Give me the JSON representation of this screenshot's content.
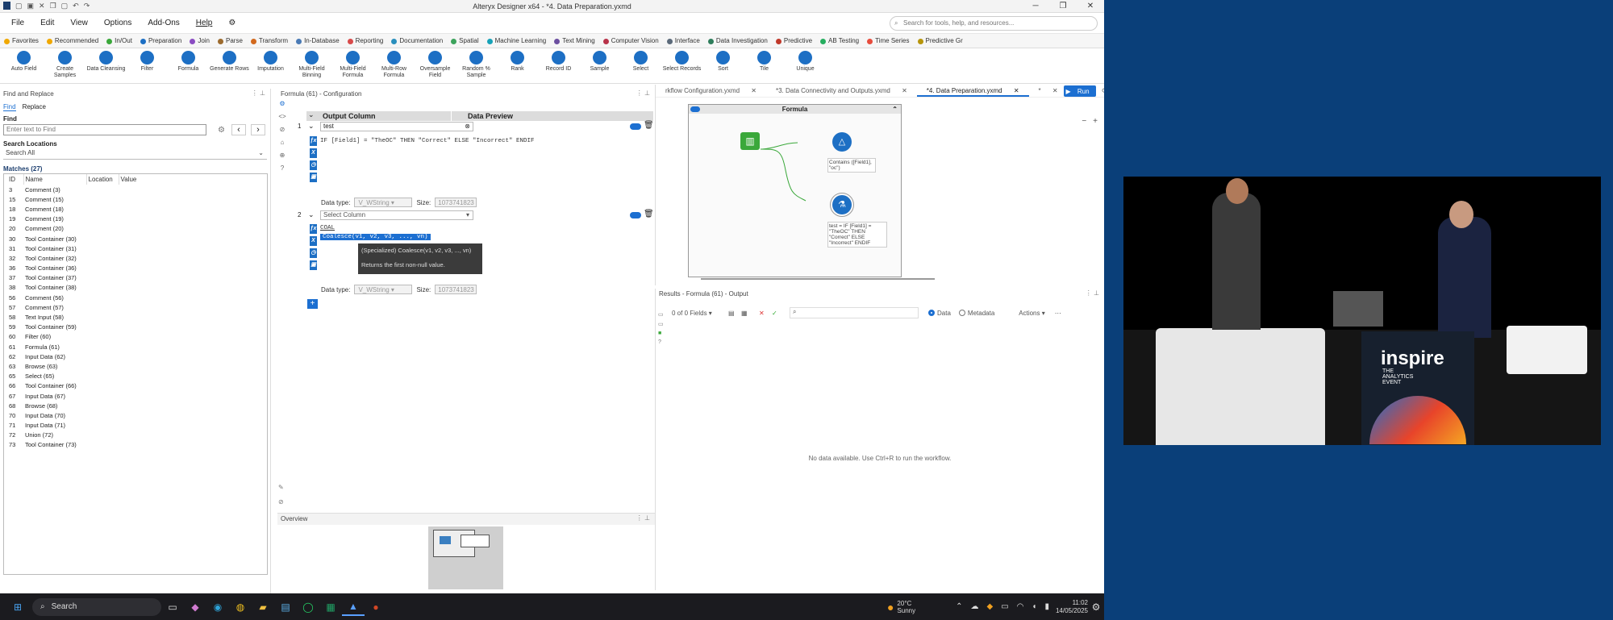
{
  "app": {
    "title": "Alteryx Designer x64 - *4. Data Preparation.yxmd",
    "menu": [
      "File",
      "Edit",
      "View",
      "Options",
      "Add-Ons",
      "Help"
    ],
    "search_placeholder": "Search for tools, help, and resources..."
  },
  "categories": [
    {
      "label": "Favorites",
      "color": "#f0a800"
    },
    {
      "label": "Recommended",
      "color": "#f0a800"
    },
    {
      "label": "In/Out",
      "color": "#3aa83a"
    },
    {
      "label": "Preparation",
      "color": "#1d6fc4",
      "active": true
    },
    {
      "label": "Join",
      "color": "#8a4cc2"
    },
    {
      "label": "Parse",
      "color": "#9c6b2e"
    },
    {
      "label": "Transform",
      "color": "#d2691e"
    },
    {
      "label": "In-Database",
      "color": "#4a7ab5"
    },
    {
      "label": "Reporting",
      "color": "#d84a4a"
    },
    {
      "label": "Documentation",
      "color": "#2a8fbd"
    },
    {
      "label": "Spatial",
      "color": "#3ca35c"
    },
    {
      "label": "Machine Learning",
      "color": "#17a2b8"
    },
    {
      "label": "Text Mining",
      "color": "#6c4fa0"
    },
    {
      "label": "Computer Vision",
      "color": "#b8334a"
    },
    {
      "label": "Interface",
      "color": "#5b6a7a"
    },
    {
      "label": "Data Investigation",
      "color": "#2e7d5b"
    },
    {
      "label": "Predictive",
      "color": "#c0392b"
    },
    {
      "label": "AB Testing",
      "color": "#27ae60"
    },
    {
      "label": "Time Series",
      "color": "#e74c3c"
    },
    {
      "label": "Predictive Gr",
      "color": "#b7950b"
    }
  ],
  "tools": [
    [
      "Auto Field"
    ],
    [
      "Create",
      "Samples"
    ],
    [
      "Data Cleansing"
    ],
    [
      "Filter"
    ],
    [
      "Formula"
    ],
    [
      "Generate Rows"
    ],
    [
      "Imputation"
    ],
    [
      "Multi-Field",
      "Binning"
    ],
    [
      "Multi-Field",
      "Formula"
    ],
    [
      "Multi-Row",
      "Formula"
    ],
    [
      "Oversample",
      "Field"
    ],
    [
      "Random %",
      "Sample"
    ],
    [
      "Rank"
    ],
    [
      "Record ID"
    ],
    [
      "Sample"
    ],
    [
      "Select"
    ],
    [
      "Select Records"
    ],
    [
      "Sort"
    ],
    [
      "Tile"
    ],
    [
      "Unique"
    ]
  ],
  "find": {
    "panel_title": "Find and Replace",
    "tab_find": "Find",
    "tab_replace": "Replace",
    "find_label": "Find",
    "find_placeholder": "Enter text to Find",
    "locations_label": "Search Locations",
    "locations_value": "Search All",
    "matches_label": "Matches (27)",
    "columns": [
      "ID",
      "Name",
      "Location",
      "Value"
    ],
    "rows": [
      [
        "3",
        "Comment (3)"
      ],
      [
        "15",
        "Comment (15)"
      ],
      [
        "18",
        "Comment (18)"
      ],
      [
        "19",
        "Comment (19)"
      ],
      [
        "20",
        "Comment (20)"
      ],
      [
        "30",
        "Tool Container (30)"
      ],
      [
        "31",
        "Tool Container (31)"
      ],
      [
        "32",
        "Tool Container (32)"
      ],
      [
        "36",
        "Tool Container (36)"
      ],
      [
        "37",
        "Tool Container (37)"
      ],
      [
        "38",
        "Tool Container (38)"
      ],
      [
        "56",
        "Comment (56)"
      ],
      [
        "57",
        "Comment (57)"
      ],
      [
        "58",
        "Text Input (58)"
      ],
      [
        "59",
        "Tool Container (59)"
      ],
      [
        "60",
        "Filter (60)"
      ],
      [
        "61",
        "Formula (61)"
      ],
      [
        "62",
        "Input Data (62)"
      ],
      [
        "63",
        "Browse (63)"
      ],
      [
        "65",
        "Select (65)"
      ],
      [
        "66",
        "Tool Container (66)"
      ],
      [
        "67",
        "Input Data (67)"
      ],
      [
        "68",
        "Browse (68)"
      ],
      [
        "70",
        "Input Data (70)"
      ],
      [
        "71",
        "Input Data (71)"
      ],
      [
        "72",
        "Union (72)"
      ],
      [
        "73",
        "Tool Container (73)"
      ]
    ]
  },
  "config": {
    "panel_title": "Formula (61) - Configuration",
    "col_output": "Output Column",
    "col_preview": "Data Preview",
    "row1_num": "1",
    "row1_field": "test",
    "row1_expr": "IF [Field1] = \"TheOC\" THEN \"Correct\" ELSE \"Incorrect\" ENDIF",
    "datatype_label": "Data type:",
    "size_label": "Size:",
    "row1_type": "V_WString",
    "row1_size": "1073741823",
    "row2_num": "2",
    "row2_field": "Select Column",
    "row2_line1": "COAL",
    "row2_line2": "Coalesce(v1, v2, v3, ..., vn)",
    "row2_type": "V_WString",
    "row2_size": "1073741823",
    "tooltip_sig": "(Specialized) Coalesce(v1, v2, v3, ..., vn)",
    "tooltip_desc": "Returns the first non-null value."
  },
  "tabs": [
    "rkflow Configuration.yxmd",
    "*3. Data Connectivity and Outputs.yxmd",
    "*4. Data Preparation.yxmd",
    "*"
  ],
  "run_label": "Run",
  "canvas": {
    "container_title": "Formula",
    "filter_note": "Contains ([Field1], \"oc\")",
    "formula_note": "test = IF [Field1] = \"TheOC\" THEN \"Correct\" ELSE \"Incorrect\" ENDIF"
  },
  "results": {
    "panel_title": "Results - Formula (61) - Output",
    "fields": "0 of 0 Fields",
    "data_label": "Data",
    "metadata_label": "Metadata",
    "actions_label": "Actions",
    "empty": "No data available. Use Ctrl+R to run the workflow."
  },
  "overview": {
    "panel_title": "Overview"
  },
  "taskbar": {
    "search": "Search",
    "temp": "20°C",
    "weather": "Sunny",
    "time": "11:02",
    "date": "14/05/2025"
  },
  "video": {
    "brand": "inspire",
    "sub1": "THE",
    "sub2": "ANALYTICS",
    "sub3": "EVENT"
  }
}
